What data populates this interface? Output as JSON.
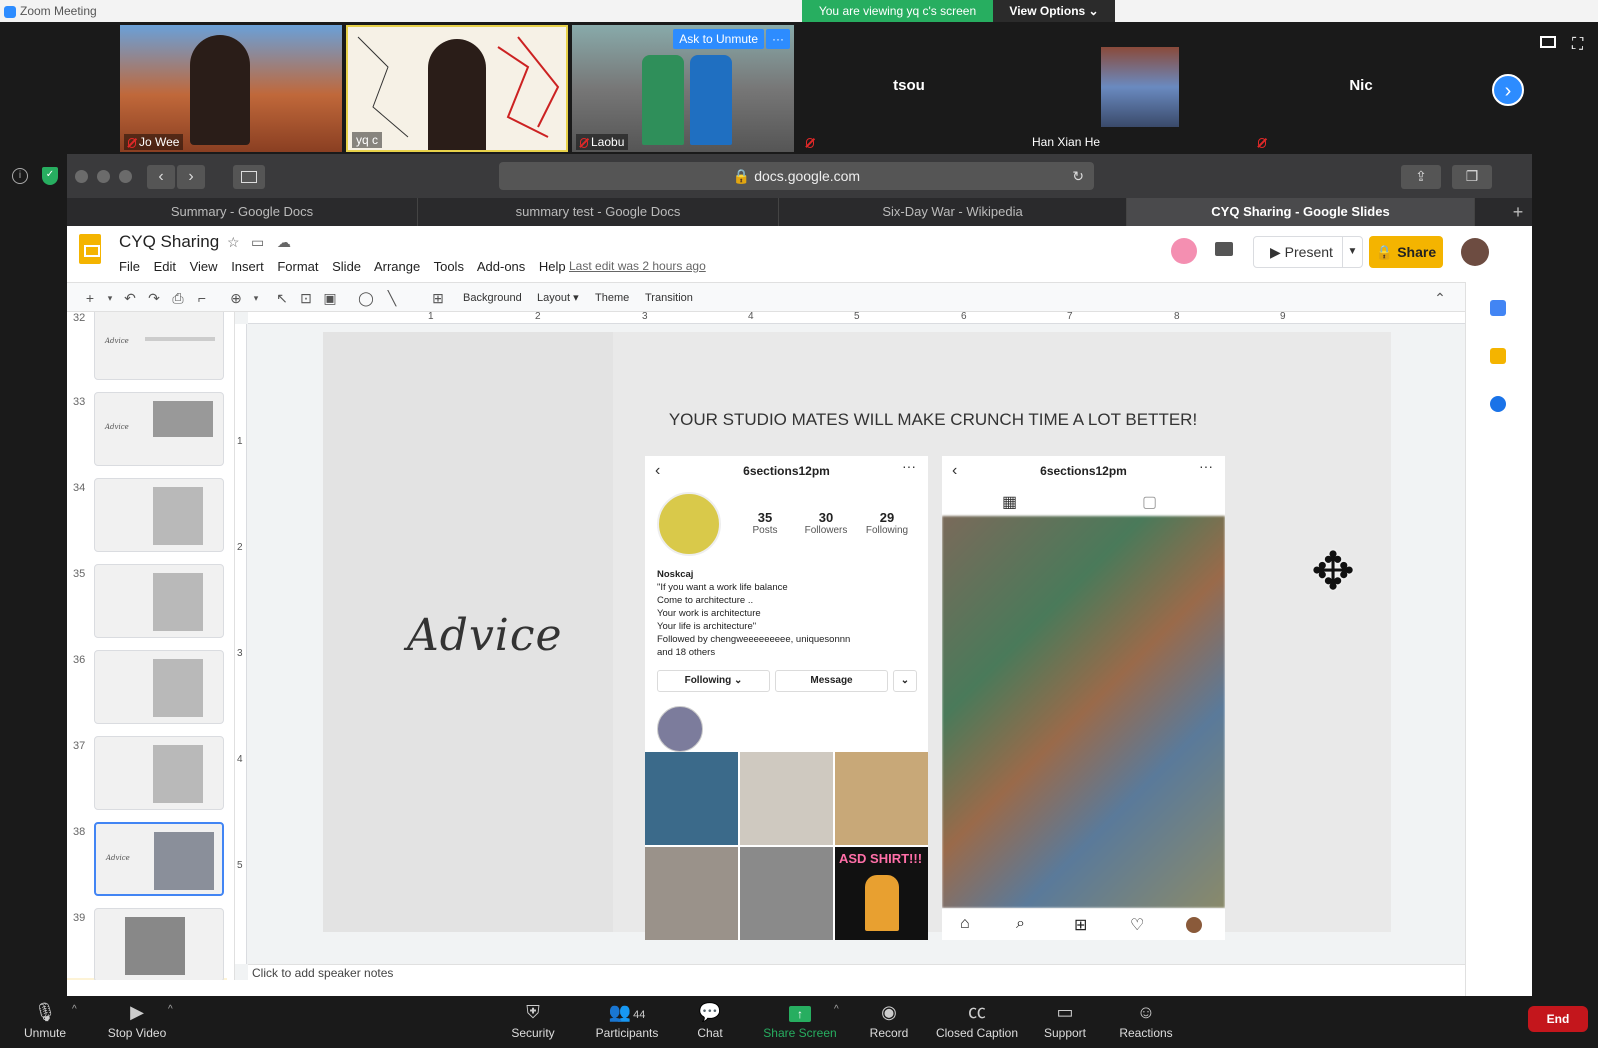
{
  "titlebar": {
    "title": "Zoom Meeting"
  },
  "banner": {
    "viewing": "You are viewing yq c's screen",
    "view_options": "View Options ⌄"
  },
  "participants": [
    {
      "name": "Jo Wee"
    },
    {
      "name": "yq c"
    },
    {
      "name": "Laobu",
      "ask_unmute": "Ask to Unmute",
      "more": "···"
    },
    {
      "name": "tsou"
    },
    {
      "name": "Han Xian He"
    },
    {
      "name": "Nic"
    }
  ],
  "browser": {
    "address": "docs.google.com",
    "tabs": [
      "Summary - Google Docs",
      "summary test - Google Docs",
      "Six-Day War - Wikipedia",
      "CYQ Sharing - Google Slides"
    ],
    "add_tab": "+"
  },
  "slides_app": {
    "doc_title": "CYQ Sharing",
    "menus": [
      "File",
      "Edit",
      "View",
      "Insert",
      "Format",
      "Slide",
      "Arrange",
      "Tools",
      "Add-ons",
      "Help"
    ],
    "last_edit": "Last edit was 2 hours ago",
    "present": "Present",
    "share": "Share",
    "toolbar": {
      "background": "Background",
      "layout": "Layout ▾",
      "theme": "Theme",
      "transition": "Transition"
    },
    "notes_placeholder": "Click to add speaker notes"
  },
  "filmstrip": {
    "numbers": [
      "32",
      "33",
      "34",
      "35",
      "36",
      "37",
      "38",
      "39"
    ],
    "selected": "38",
    "thumb_label": "Advice"
  },
  "ruler": {
    "h_ticks": [
      "1",
      "2",
      "3",
      "4",
      "5",
      "6",
      "7",
      "8",
      "9"
    ],
    "v_ticks": [
      "1",
      "2",
      "3",
      "4",
      "5"
    ]
  },
  "slide": {
    "left_title": "Advice",
    "headline": "YOUR STUDIO MATES WILL MAKE CRUNCH TIME A LOT BETTER!",
    "profile": {
      "username": "6sections12pm",
      "posts_n": "35",
      "posts_l": "Posts",
      "followers_n": "30",
      "followers_l": "Followers",
      "following_n": "29",
      "following_l": "Following",
      "bio_name": "Noskcaj",
      "bio_1": "\"If you want a work life balance",
      "bio_2": "Come to architecture ..",
      "bio_3": "Your work is architecture",
      "bio_4": "Your life is architecture\"",
      "followed_by": "Followed by chengweeeeeeeee, uniquesonnn",
      "and_others": "and 18 others",
      "following_btn": "Following ⌄",
      "message_btn": "Message",
      "dropdown_btn": "⌄",
      "shirt_text": "ASD SHIRT!!!"
    }
  },
  "controls": {
    "unmute": "Unmute",
    "stop_video": "Stop Video",
    "security": "Security",
    "participants": "Participants",
    "participants_count": "44",
    "chat": "Chat",
    "share_screen": "Share Screen",
    "record": "Record",
    "closed_caption": "Closed Caption",
    "support": "Support",
    "reactions": "Reactions",
    "end": "End"
  },
  "colors": {
    "zoom_blue": "#2d8cff",
    "share_green": "#27ae60",
    "end_red": "#c4161c",
    "slides_yellow": "#f4b400"
  }
}
